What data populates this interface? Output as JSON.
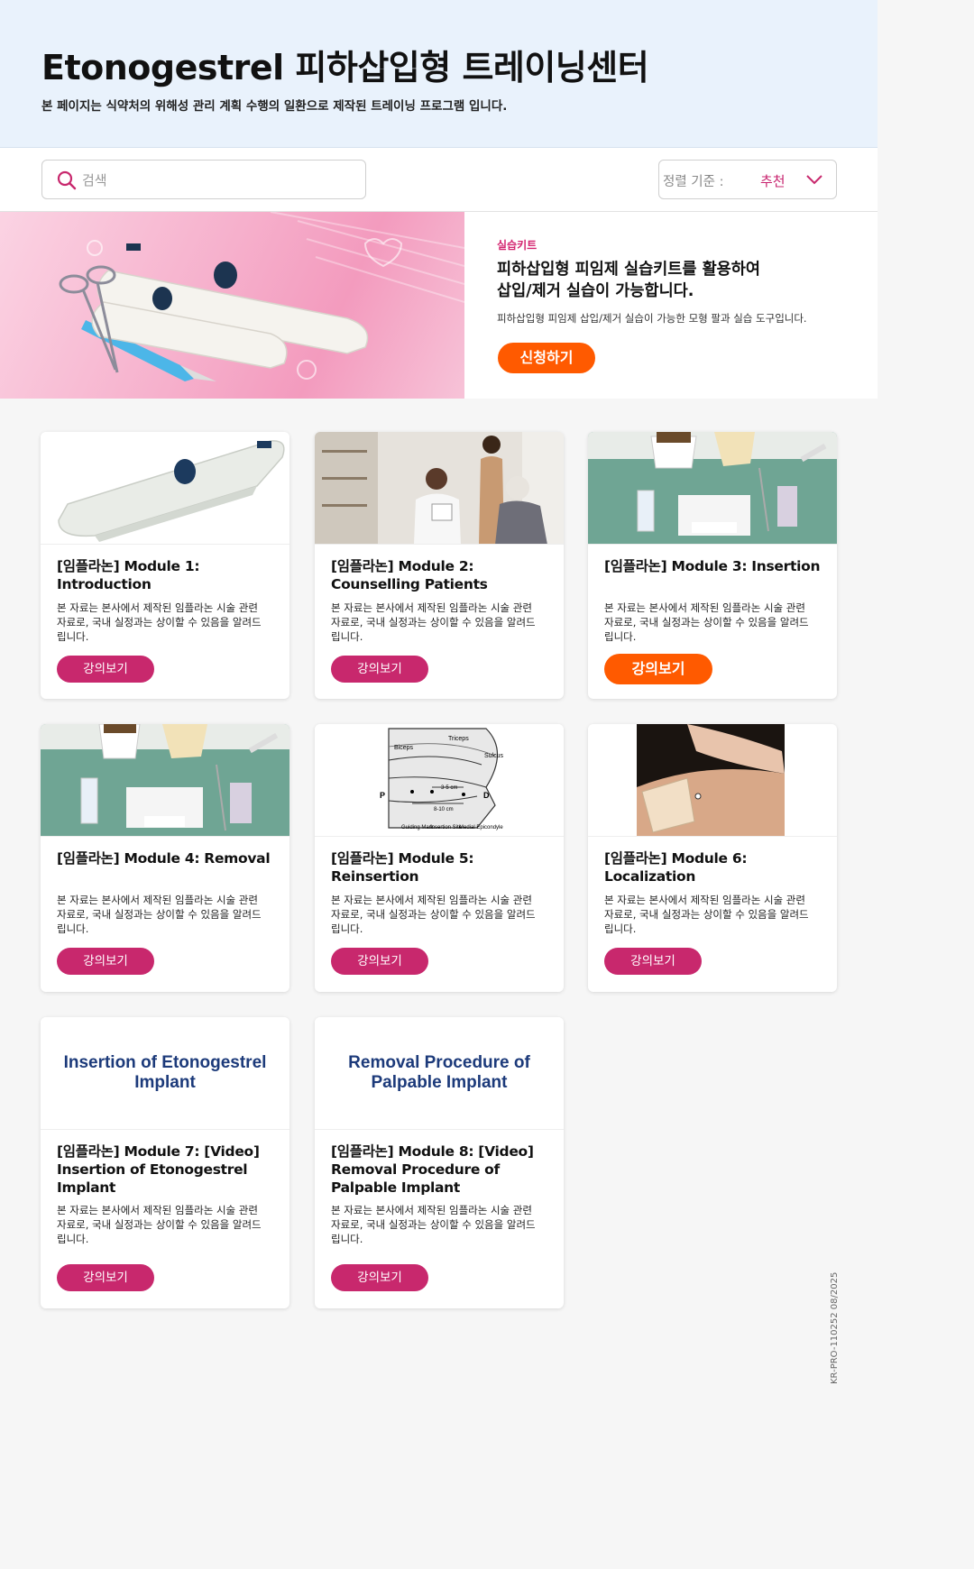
{
  "header": {
    "title": "Etonogestrel 피하삽입형 트레이닝센터",
    "subtitle": "본 페이지는 식약처의 위해성 관리 계획 수행의 일환으로 제작된 트레이닝 프로그램 입니다."
  },
  "search": {
    "placeholder": "검색",
    "value": ""
  },
  "sort": {
    "label": "정렬 기준 :",
    "value": "추천"
  },
  "banner": {
    "tag": "실습키트",
    "title_line1": "피하삽입형 피임제 실습키트를 활용하여",
    "title_line2": "삽입/제거 실습이 가능합니다.",
    "description": "피하삽입형 피임제 삽입/제거 실습이 가능한 모형 팔과 실습 도구입니다.",
    "button": "신청하기"
  },
  "cards": [
    {
      "title": "[임플라논] Module 1: Introduction",
      "description": "본 자료는 본사에서 제작된 임플라논 시술 관련 자료로, 국내 실정과는 상이할 수 있음을 알려드립니다.",
      "button": "강의보기"
    },
    {
      "title": "[임플라논] Module 2: Counselling Patients",
      "description": "본 자료는 본사에서 제작된 임플라논 시술 관련 자료로, 국내 실정과는 상이할 수 있음을 알려드립니다.",
      "button": "강의보기"
    },
    {
      "title": "[임플라논] Module 3: Insertion",
      "description": "본 자료는 본사에서 제작된 임플라논 시술 관련 자료로, 국내 실정과는 상이할 수 있음을 알려드립니다.",
      "button": "강의보기"
    },
    {
      "title": "[임플라논] Module 4: Removal",
      "description": "본 자료는 본사에서 제작된 임플라논 시술 관련 자료로, 국내 실정과는 상이할 수 있음을 알려드립니다.",
      "button": "강의보기"
    },
    {
      "title": "[임플라논] Module 5: Reinsertion",
      "description": "본 자료는 본사에서 제작된 임플라논 시술 관련 자료로, 국내 실정과는 상이할 수 있음을 알려드립니다.",
      "button": "강의보기"
    },
    {
      "title": "[임플라논] Module 6: Localization",
      "description": "본 자료는 본사에서 제작된 임플라논 시술 관련 자료로, 국내 실정과는 상이할 수 있음을 알려드립니다.",
      "button": "강의보기"
    },
    {
      "title": "[임플라논] Module 7: [Video] Insertion of Etonogestrel Implant",
      "description": "본 자료는 본사에서 제작된 임플라논 시술 관련 자료로, 국내 실정과는 상이할 수 있음을 알려드립니다.",
      "button": "강의보기",
      "thumb_text": "Insertion of Etonogestrel Implant"
    },
    {
      "title": "[임플라논] Module 8: [Video] Removal Procedure of Palpable Implant",
      "description": "본 자료는 본사에서 제작된 임플라논 시술 관련 자료로, 국내 실정과는 상이할 수 있음을 알려드립니다.",
      "button": "강의보기",
      "thumb_text": "Removal Procedure of Palpable Implant"
    }
  ],
  "diagram_labels": {
    "triceps": "Triceps",
    "biceps": "Biceps",
    "sulcus": "Sulcus",
    "p": "P",
    "d": "D",
    "cm1": "3-5 cm",
    "cm2": "8-10 cm",
    "guiding": "Guiding Mark",
    "insertion": "Insertion Site",
    "medial": "Medial Epicondyle"
  },
  "footer_code": "KR-PRO-110252 08/2025",
  "colors": {
    "accent_pink": "#c8286d",
    "accent_orange": "#ff5a00",
    "header_bg": "#e9f2fc"
  }
}
